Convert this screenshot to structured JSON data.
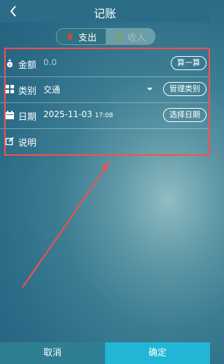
{
  "header": {
    "title": "记账"
  },
  "toggle": {
    "expense_label": "支出",
    "income_label": "收入"
  },
  "form": {
    "amount": {
      "label": "金额",
      "placeholder": "0.0",
      "button": "算一算"
    },
    "category": {
      "label": "类别",
      "value": "交通",
      "button": "管理类别"
    },
    "date": {
      "label": "日期",
      "date": "2025-11-03",
      "time": "17:08",
      "button": "选择日期"
    },
    "note": {
      "label": "说明"
    }
  },
  "footer": {
    "cancel_label": "取消",
    "confirm_label": "确定"
  },
  "colors": {
    "accent": "#22b5d6",
    "expense_arrow": "#e0403a",
    "income_arrow": "#7fa34a",
    "annotation": "#ff4d4d"
  }
}
